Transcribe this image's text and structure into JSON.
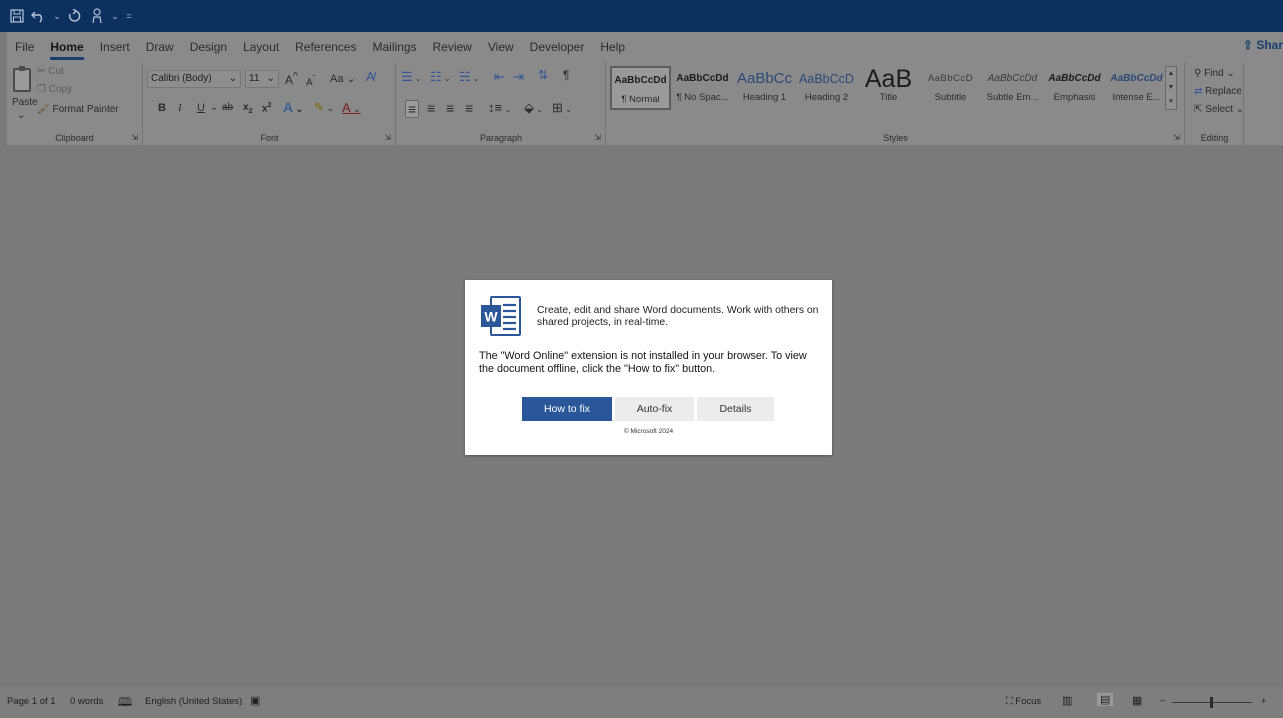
{
  "qat": {
    "save_icon": "save-icon",
    "undo_icon": "undo-icon",
    "redo_icon": "redo-icon",
    "touch_icon": "touch-mode-icon"
  },
  "tabs": [
    "File",
    "Home",
    "Insert",
    "Draw",
    "Design",
    "Layout",
    "References",
    "Mailings",
    "Review",
    "View",
    "Developer",
    "Help"
  ],
  "active_tab": "Home",
  "share_label": "Shar",
  "clipboard": {
    "paste": "Paste",
    "cut": "Cut",
    "copy": "Copy",
    "format_painter": "Format Painter",
    "group_label": "Clipboard"
  },
  "font": {
    "family": "Calibri (Body)",
    "size": "11",
    "grow": "A",
    "shrink": "A",
    "change_case": "Aa",
    "bold": "B",
    "italic": "I",
    "underline": "U",
    "strike": "ab",
    "subscript": "x",
    "superscript": "x",
    "text_effects": "A",
    "font_color": "A",
    "group_label": "Font"
  },
  "paragraph": {
    "group_label": "Paragraph"
  },
  "styles": {
    "items": [
      {
        "sample": "AaBbCcDd",
        "name": "¶ Normal"
      },
      {
        "sample": "AaBbCcDd",
        "name": "¶ No Spac..."
      },
      {
        "sample": "AaBbCc",
        "name": "Heading 1"
      },
      {
        "sample": "AaBbCcD",
        "name": "Heading 2"
      },
      {
        "sample": "AaB",
        "name": "Title"
      },
      {
        "sample": "AaBbCcD",
        "name": "Subtitle"
      },
      {
        "sample": "AaBbCcDd",
        "name": "Subtle Em..."
      },
      {
        "sample": "AaBbCcDd",
        "name": "Emphasis"
      },
      {
        "sample": "AaBbCcDd",
        "name": "Intense E..."
      }
    ],
    "group_label": "Styles"
  },
  "editing": {
    "find": "Find",
    "replace": "Replace",
    "select": "Select",
    "group_label": "Editing"
  },
  "dialog": {
    "intro": "Create, edit and share Word documents. Work with others on shared projects, in real-time.",
    "message": "The \"Word Online\" extension is not installed in your browser. To view the document offline, click the \"How to fix\" button.",
    "how_to_fix": "How to fix",
    "auto_fix": "Auto-fix",
    "details": "Details",
    "copyright": "© Microsoft 2024",
    "logo_letter": "W",
    "colors": {
      "primary": "#2b579a"
    }
  },
  "status": {
    "page": "Page 1 of 1",
    "words": "0 words",
    "language": "English (United States)",
    "focus": "Focus",
    "zoom_minus": "−",
    "zoom_plus": "+"
  },
  "colors": {
    "titlebar": "#0c3160",
    "overlay_bg": "#7a7a7a",
    "accent": "#1a3e6d"
  }
}
